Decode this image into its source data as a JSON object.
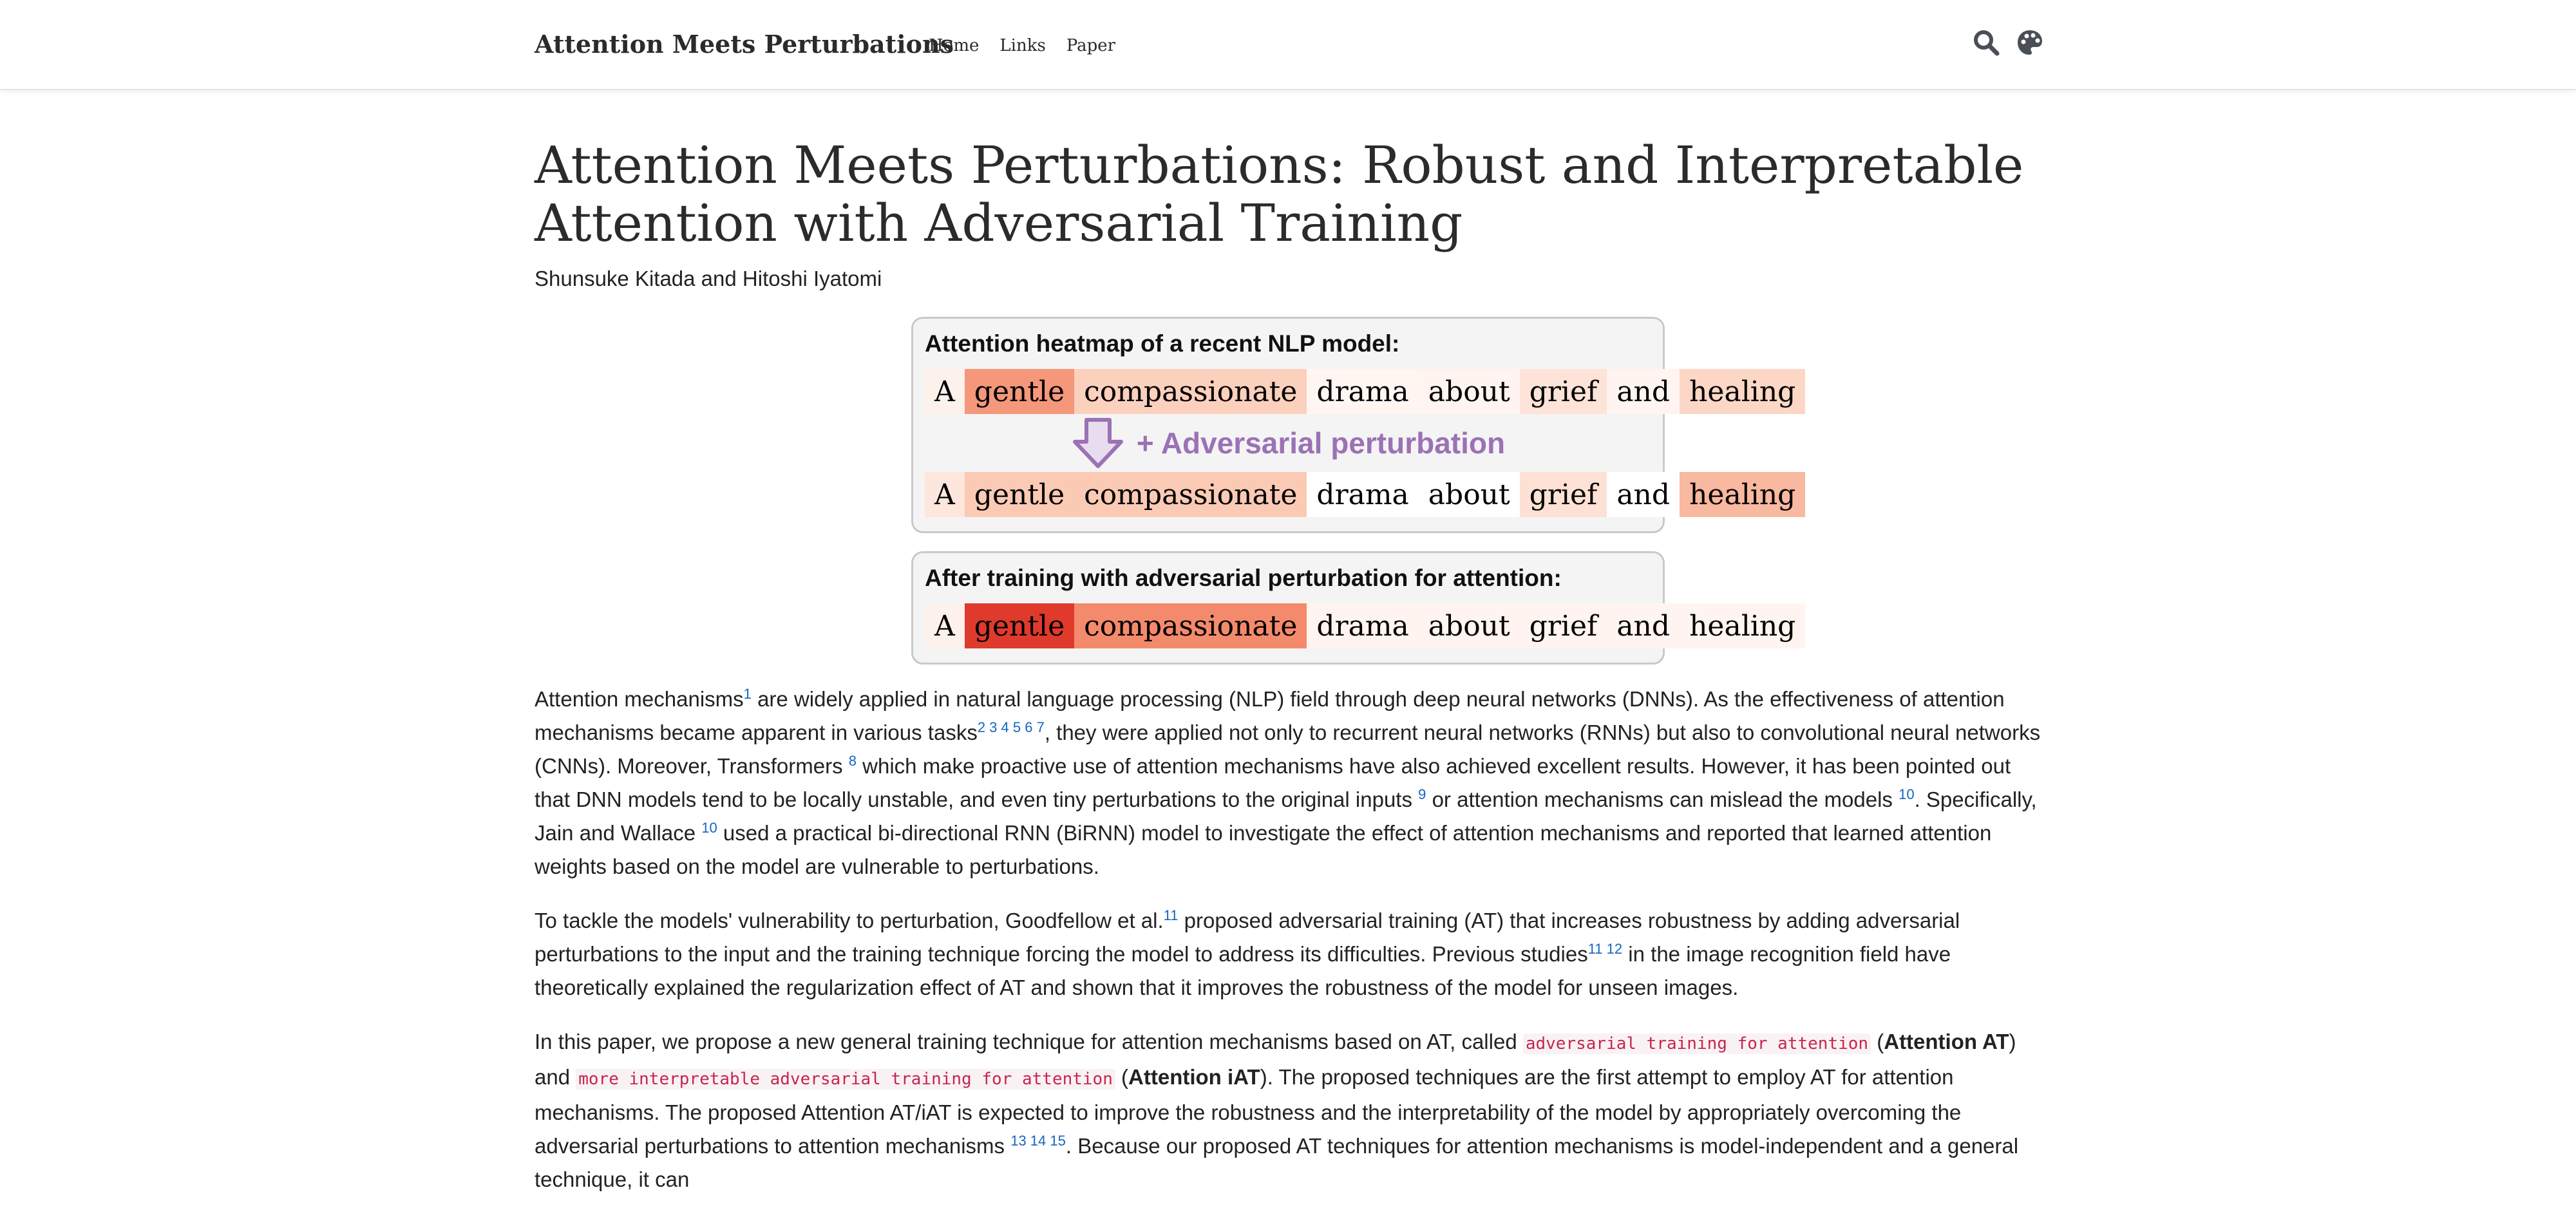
{
  "navbar": {
    "brand": "Attention Meets Perturbations",
    "links": [
      "Home",
      "Links",
      "Paper"
    ],
    "icons": [
      "search-icon",
      "palette-icon"
    ]
  },
  "page": {
    "title": "Attention Meets Perturbations: Robust and Interpretable Attention with Adversarial Training",
    "authors": "Shunsuke Kitada and Hitoshi Iyatomi"
  },
  "figure": {
    "panel1": {
      "heading": "Attention heatmap of a recent NLP model:",
      "perturbation_label": "+ Adversarial perturbation",
      "row_original": [
        {
          "word": "A",
          "color": "#fdf1ec"
        },
        {
          "word": "gentle",
          "color": "#f4977a"
        },
        {
          "word": "compassionate",
          "color": "#fbd0bd"
        },
        {
          "word": "drama",
          "color": "#fff6f2"
        },
        {
          "word": "about",
          "color": "#fff4ef"
        },
        {
          "word": "grief",
          "color": "#fde3d8"
        },
        {
          "word": "and",
          "color": "#fff4ef"
        },
        {
          "word": "healing",
          "color": "#fcd7c6"
        }
      ],
      "row_perturbed": [
        {
          "word": "A",
          "color": "#fde7dd"
        },
        {
          "word": "gentle",
          "color": "#fbcab5"
        },
        {
          "word": "compassionate",
          "color": "#fbcab5"
        },
        {
          "word": "drama",
          "color": "#ffffff"
        },
        {
          "word": "about",
          "color": "#ffffff"
        },
        {
          "word": "grief",
          "color": "#fde1d4"
        },
        {
          "word": "and",
          "color": "#ffffff"
        },
        {
          "word": "healing",
          "color": "#f9b8a0"
        }
      ]
    },
    "panel2": {
      "heading": "After training with adversarial perturbation for attention:",
      "row": [
        {
          "word": "A",
          "color": "#fdf1ec"
        },
        {
          "word": "gentle",
          "color": "#e03a2c"
        },
        {
          "word": "compassionate",
          "color": "#f48a6c"
        },
        {
          "word": "drama",
          "color": "#fff4ef"
        },
        {
          "word": "about",
          "color": "#fff4ef"
        },
        {
          "word": "grief",
          "color": "#fff4ef"
        },
        {
          "word": "and",
          "color": "#fff4ef"
        },
        {
          "word": "healing",
          "color": "#fff4ef"
        }
      ]
    }
  },
  "paragraphs": {
    "p1": {
      "t1": "Attention mechanisms",
      "s1": "1",
      "t2": " are widely applied in natural language processing (NLP) field through deep neural networks (DNNs). As the effectiveness of attention mechanisms became apparent in various tasks",
      "s2": "2 3 4 5 6 7",
      "t3": ", they were applied not only to recurrent neural networks (RNNs) but also to convolutional neural networks (CNNs). Moreover, Transformers ",
      "s3": "8",
      "t4": " which make proactive use of attention mechanisms have also achieved excellent results. However, it has been pointed out that DNN models tend to be locally unstable, and even tiny perturbations to the original inputs ",
      "s4": "9",
      "t5": " or attention mechanisms can mislead the models ",
      "s5": "10",
      "t6": ". Specifically, Jain and Wallace ",
      "s6": "10",
      "t7": " used a practical bi-directional RNN (BiRNN) model to investigate the effect of attention mechanisms and reported that learned attention weights based on the model are vulnerable to perturbations."
    },
    "p2": {
      "t1": "To tackle the models' vulnerability to perturbation, Goodfellow et al.",
      "s1": "11",
      "t2": " proposed adversarial training (AT) that increases robustness by adding adversarial perturbations to the input and the training technique forcing the model to address its difficulties. Previous studies",
      "s2": "11 12",
      "t3": " in the image recognition field have theoretically explained the regularization effect of AT and shown that it improves the robustness of the model for unseen images."
    },
    "p3": {
      "t1": "In this paper, we propose a new general training technique for attention mechanisms based on AT, called ",
      "c1": "adversarial training for attention",
      "t2": " (",
      "b1": "Attention AT",
      "t3": ") and ",
      "c2": "more interpretable adversarial training for attention",
      "t4": " (",
      "b2": "Attention iAT",
      "t5": "). The proposed techniques are the first attempt to employ AT for attention mechanisms. The proposed Attention AT/iAT is expected to improve the robustness and the interpretability of the model by appropriately overcoming the adversarial perturbations to attention mechanisms ",
      "s1": "13 14 15",
      "t6": ". Because our proposed AT techniques for attention mechanisms is model-independent and a general technique, it can"
    }
  }
}
